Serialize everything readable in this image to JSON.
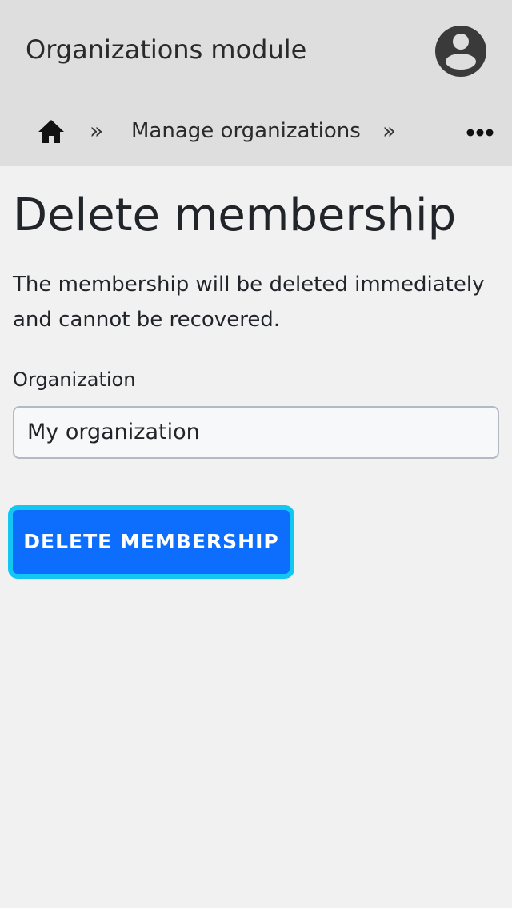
{
  "header": {
    "app_title": "Organizations module",
    "avatar_icon": "user-avatar-icon"
  },
  "breadcrumb": {
    "home_icon": "home-icon",
    "separator": "»",
    "items": [
      {
        "label": "Manage organizations"
      }
    ],
    "more_icon": "more-dots-icon"
  },
  "main": {
    "title": "Delete membership",
    "description": "The membership will be deleted immediately and cannot be recovered.",
    "organization_label": "Organization",
    "organization_value": "My organization",
    "delete_button_label": "DELETE MEMBERSHIP"
  },
  "colors": {
    "header_bg": "#dedede",
    "page_bg": "#f1f1f1",
    "primary_button": "#0d6efd",
    "focus_ring": "#14c7f2"
  }
}
